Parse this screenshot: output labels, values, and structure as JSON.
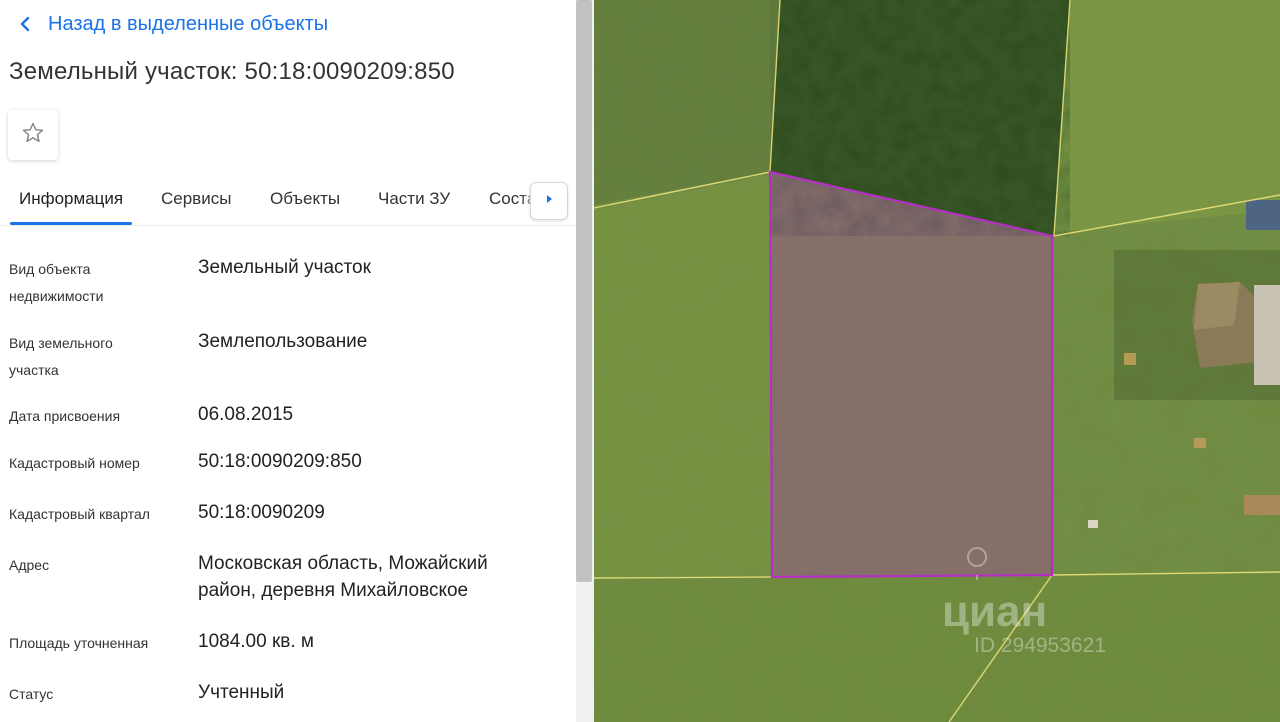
{
  "panel": {
    "back_label": "Назад в выделенные объекты",
    "title": "Земельный участок: 50:18:0090209:850",
    "favorite_icon": "star-outline-icon",
    "tabs": [
      {
        "label": "Информация",
        "active": true
      },
      {
        "label": "Сервисы",
        "active": false
      },
      {
        "label": "Объекты",
        "active": false
      },
      {
        "label": "Части ЗУ",
        "active": false
      },
      {
        "label": "Соста",
        "active": false
      }
    ],
    "tabs_next_icon": "chevron-right-icon",
    "rows": [
      {
        "label_line1": "Вид объекта",
        "label_line2": "недвижимости",
        "value": "Земельный участок"
      },
      {
        "label_line1": "Вид земельного",
        "label_line2": "участка",
        "value": "Землепользование"
      },
      {
        "label": "Дата присвоения",
        "value": "06.08.2015"
      },
      {
        "label": "Кадастровый номер",
        "value": "50:18:0090209:850"
      },
      {
        "label": "Кадастровый квартал",
        "value": "50:18:0090209"
      },
      {
        "label": "Адрес",
        "value_line1": "Московская область, Можайский",
        "value_line2": "район, деревня Михайловское"
      },
      {
        "label": "Площадь уточненная",
        "value": "1084.00 кв. м"
      },
      {
        "label": "Статус",
        "value": "Учтенный"
      }
    ]
  },
  "map": {
    "parcel_color": "#b52fc4",
    "boundary_color": "#e8e07a",
    "watermark_brand": "циан",
    "watermark_id": "ID 294953621"
  }
}
